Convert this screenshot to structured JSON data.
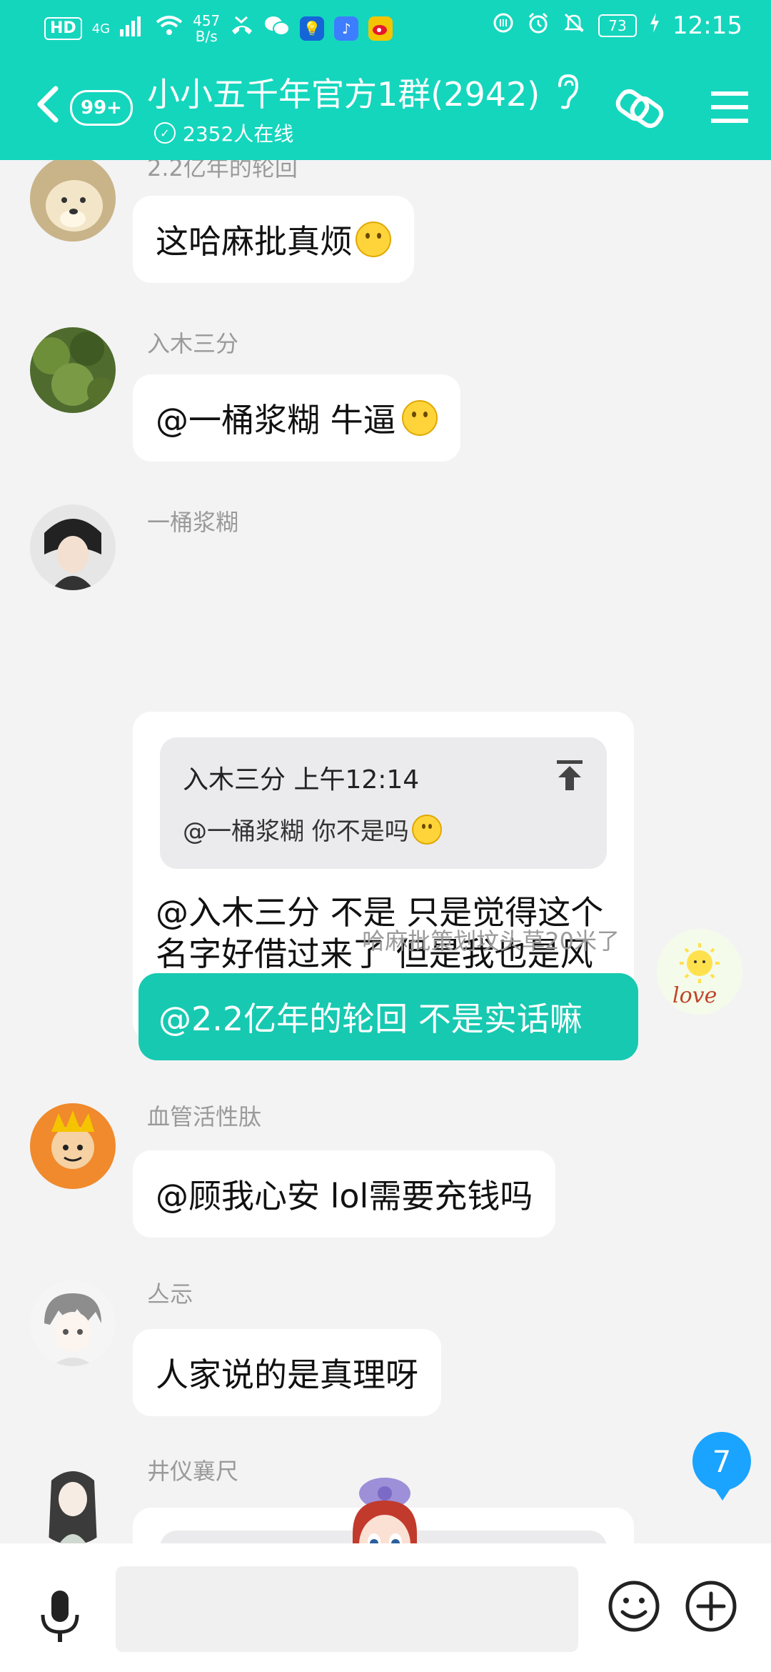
{
  "status_bar": {
    "hd": "HD",
    "network": "4G",
    "net_speed": "457\nB/s",
    "battery": "73",
    "time": "12:15"
  },
  "header": {
    "unread": "99+",
    "title": "小小五千年官方1群(2942)",
    "online": "2352人在线"
  },
  "messages": [
    {
      "nick": "2.2亿年的轮回",
      "text": "这哈麻批真烦"
    },
    {
      "nick": "入木三分",
      "text": "@一桶浆糊 牛逼"
    },
    {
      "nick": "一桶浆糊",
      "quote_head": "入木三分 上午12:14",
      "quote_body": "@一桶浆糊 你不是吗",
      "text": "@入木三分 不是 只是觉得这个名字好借过来了 但是我也是风神的"
    },
    {
      "nick": "血管活性肽",
      "text": "@顾我心安 lol需要充钱吗"
    },
    {
      "nick": "亼忈",
      "text": "人家说的是真理呀"
    },
    {
      "nick": "井仪襄尺",
      "text": ""
    }
  ],
  "self_message": {
    "nick": "哈麻批策划坟头草20米了",
    "text": "@2.2亿年的轮回 不是实话嘛",
    "avatar_text": "love"
  },
  "new_messages_count": "7",
  "input": {
    "placeholder": "",
    "value": ""
  }
}
